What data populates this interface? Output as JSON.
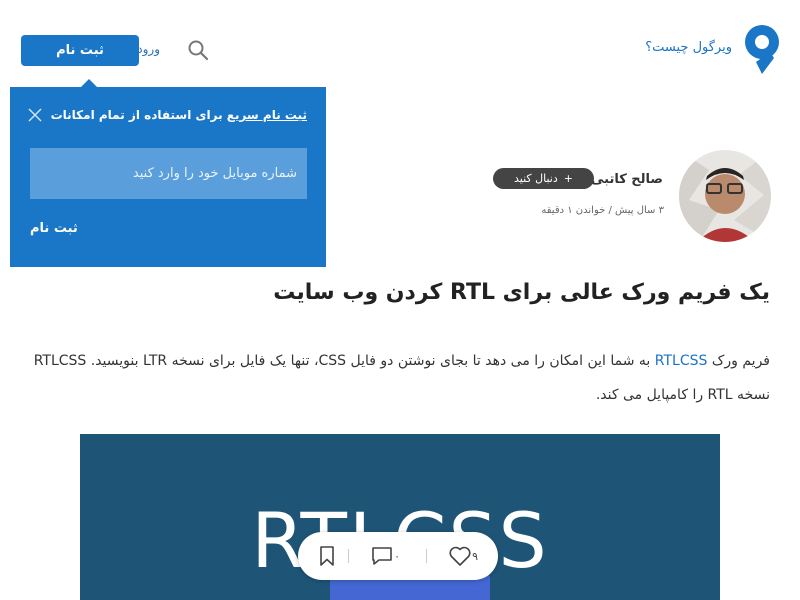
{
  "header": {
    "what_is_label": "ویرگول چیست؟",
    "signup_label": "ثبت نام",
    "login_label": "ورود"
  },
  "popup": {
    "title_part1": "ثبت نام سریع",
    "title_part2": " برای استفاده از تمام امکانات",
    "phone_placeholder": "شماره موبایل خود را وارد کنید",
    "submit_label": "ثبت نام"
  },
  "author": {
    "name": "صالح کاتبی",
    "follow_label": "دنبال کنید",
    "follow_plus": "+",
    "meta": "۳ سال پیش / خواندن ۱ دقیقه"
  },
  "post": {
    "title": "یک فریم ورک عالی برای RTL کردن وب سایت",
    "body_before_link": "فریم ورک ",
    "body_link": "RTLCSS",
    "body_after_link": " به شما این امکان را می دهد تا بجای نوشتن دو فایل CSS، تنها یک فایل برای نسخه LTR بنویسید. RTLCSS نسخه RTL را کامپایل می کند.",
    "hero_text": "RTLCSS"
  },
  "actions": {
    "likes": "۹",
    "comments": "۰"
  },
  "colors": {
    "accent": "#1a77c8",
    "hero_bg": "#1e5577"
  }
}
